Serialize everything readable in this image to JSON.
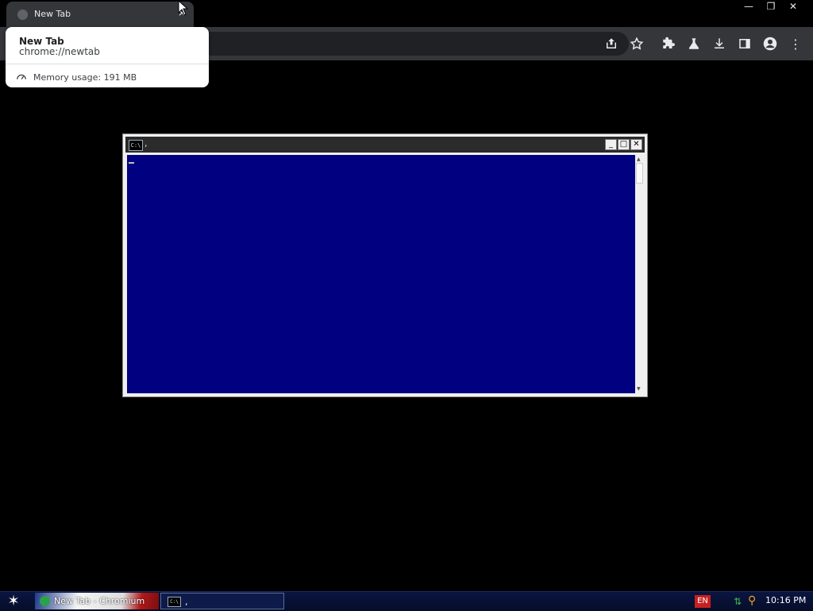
{
  "browser": {
    "tab": {
      "title": "New Tab",
      "favicon": "globe-icon",
      "close_glyph": "×"
    },
    "window_controls": {
      "minimize": "—",
      "restore": "❐",
      "close": "✕"
    },
    "toolbar_icons": [
      "share-icon",
      "bookmark-star-icon",
      "extensions-icon",
      "labs-flask-icon",
      "download-icon",
      "side-panel-icon",
      "profile-icon",
      "menu-icon"
    ],
    "menu_glyph": "⋮"
  },
  "hovercard": {
    "title": "New Tab",
    "url": "chrome://newtab",
    "memory": "Memory usage: 191 MB"
  },
  "console_window": {
    "icon_text": "C:\\",
    "title": ",",
    "buttons": {
      "minimize": "_",
      "maximize": "□",
      "close": "✕"
    },
    "background_color": "#000080"
  },
  "taskbar": {
    "start_glyph": "✶",
    "tasks": [
      {
        "label": "New Tab - Chromium"
      },
      {
        "label": ",",
        "icon_text": "C:\\"
      }
    ],
    "tray": {
      "language": "EN",
      "clock": "10:16 PM"
    }
  }
}
